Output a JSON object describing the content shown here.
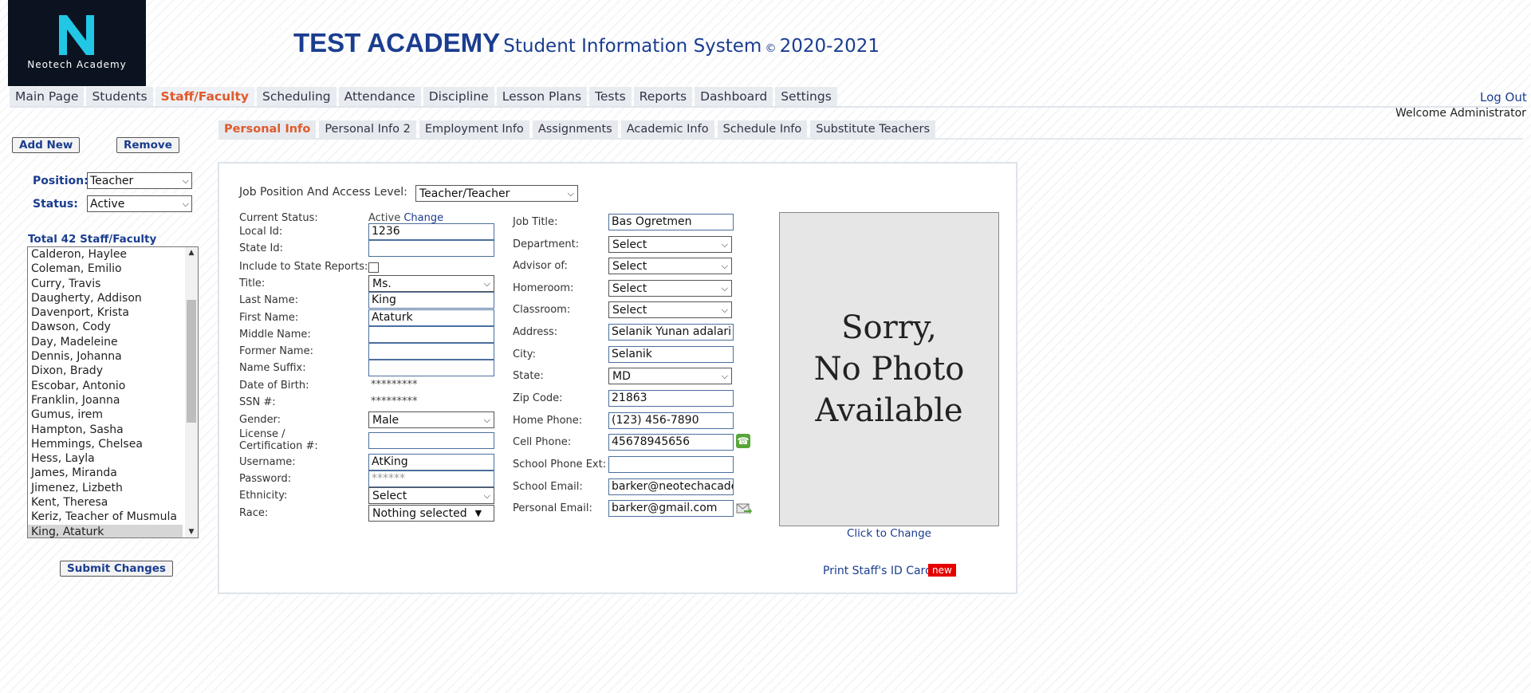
{
  "header": {
    "logo_text": "Neotech Academy",
    "title_bold": "TEST ACADEMY",
    "title_rest": "Student Information System",
    "copyright": "©",
    "year": "2020-2021"
  },
  "main_nav": {
    "items": [
      "Main Page",
      "Students",
      "Staff/Faculty",
      "Scheduling",
      "Attendance",
      "Discipline",
      "Lesson Plans",
      "Tests",
      "Reports",
      "Dashboard",
      "Settings"
    ],
    "active": "Staff/Faculty",
    "logout": "Log Out",
    "welcome": "Welcome Administrator"
  },
  "sub_nav": {
    "items": [
      "Personal Info",
      "Personal Info 2",
      "Employment Info",
      "Assignments",
      "Academic Info",
      "Schedule Info",
      "Substitute Teachers"
    ],
    "active": "Personal Info"
  },
  "left_panel": {
    "add_new": "Add New",
    "remove": "Remove",
    "position_label": "Position:",
    "position_value": "Teacher",
    "status_label": "Status:",
    "status_value": "Active",
    "total_label": "Total 42 Staff/Faculty",
    "staff_list": [
      "Calderon, Haylee",
      "Coleman, Emilio",
      "Curry, Travis",
      "Daugherty, Addison",
      "Davenport, Krista",
      "Dawson, Cody",
      "Day, Madeleine",
      "Dennis, Johanna",
      "Dixon, Brady",
      "Escobar, Antonio",
      "Franklin, Joanna",
      "Gumus, irem",
      "Hampton, Sasha",
      "Hemmings, Chelsea",
      "Hess, Layla",
      "James, Miranda",
      "Jimenez, Lizbeth",
      "Kent, Theresa",
      "Keriz, Teacher of Musmula",
      "King, Ataturk"
    ],
    "selected_staff": "King, Ataturk",
    "submit": "Submit Changes"
  },
  "form": {
    "job_position_label": "Job Position And Access Level:",
    "job_position_value": "Teacher/Teacher",
    "left": {
      "current_status_label": "Current Status:",
      "current_status_value": "Active",
      "change_link": "Change",
      "local_id_label": "Local Id:",
      "local_id_value": "1236",
      "state_id_label": "State Id:",
      "state_id_value": "",
      "include_state_label": "Include to State Reports:",
      "title_label": "Title:",
      "title_value": "Ms.",
      "last_name_label": "Last Name:",
      "last_name_value": "King",
      "first_name_label": "First Name:",
      "first_name_value": "Ataturk",
      "middle_name_label": "Middle Name:",
      "middle_name_value": "",
      "former_name_label": "Former Name:",
      "former_name_value": "",
      "name_suffix_label": "Name Suffix:",
      "name_suffix_value": "",
      "dob_label": "Date of Birth:",
      "dob_value": "*********",
      "ssn_label": "SSN #:",
      "ssn_value": "*********",
      "gender_label": "Gender:",
      "gender_value": "Male",
      "license_label_1": "License /",
      "license_label_2": "Certification #:",
      "license_value": "",
      "username_label": "Username:",
      "username_value": "AtKing",
      "password_label": "Password:",
      "password_placeholder": "******",
      "ethnicity_label": "Ethnicity:",
      "ethnicity_value": "Select",
      "race_label": "Race:",
      "race_value": "Nothing selected"
    },
    "right": {
      "job_title_label": "Job Title:",
      "job_title_value": "Bas Ogretmen",
      "department_label": "Department:",
      "department_value": "Select",
      "advisor_label": "Advisor of:",
      "advisor_value": "Select",
      "homeroom_label": "Homeroom:",
      "homeroom_value": "Select",
      "classroom_label": "Classroom:",
      "classroom_value": "Select",
      "address_label": "Address:",
      "address_value": "Selanik Yunan adalari",
      "city_label": "City:",
      "city_value": "Selanik",
      "state_label": "State:",
      "state_value": "MD",
      "zip_label": "Zip Code:",
      "zip_value": "21863",
      "home_phone_label": "Home Phone:",
      "home_phone_value": "(123) 456-7890",
      "cell_phone_label": "Cell Phone:",
      "cell_phone_value": "45678945656",
      "school_phone_label": "School Phone Ext:",
      "school_phone_value": "",
      "school_email_label": "School Email:",
      "school_email_value": "barker@neotechacademy",
      "personal_email_label": "Personal Email:",
      "personal_email_value": "barker@gmail.com"
    },
    "photo_text_1": "Sorry,",
    "photo_text_2": "No Photo",
    "photo_text_3": "Available",
    "click_to_change": "Click to Change",
    "print_id": "Print Staff's ID Card",
    "new_badge": "new"
  },
  "colors": {
    "brand_blue": "#1a3d8f",
    "active_tab": "#e05a2b",
    "logo_bg": "#0b1320",
    "logo_accent": "#22c7e6",
    "badge_red": "#e60000",
    "phone_green": "#58a53a"
  },
  "icons": [
    "neotech-logo-icon",
    "chevron-down-icon",
    "scroll-up-icon",
    "scroll-down-icon",
    "phone-icon",
    "email-send-icon"
  ]
}
